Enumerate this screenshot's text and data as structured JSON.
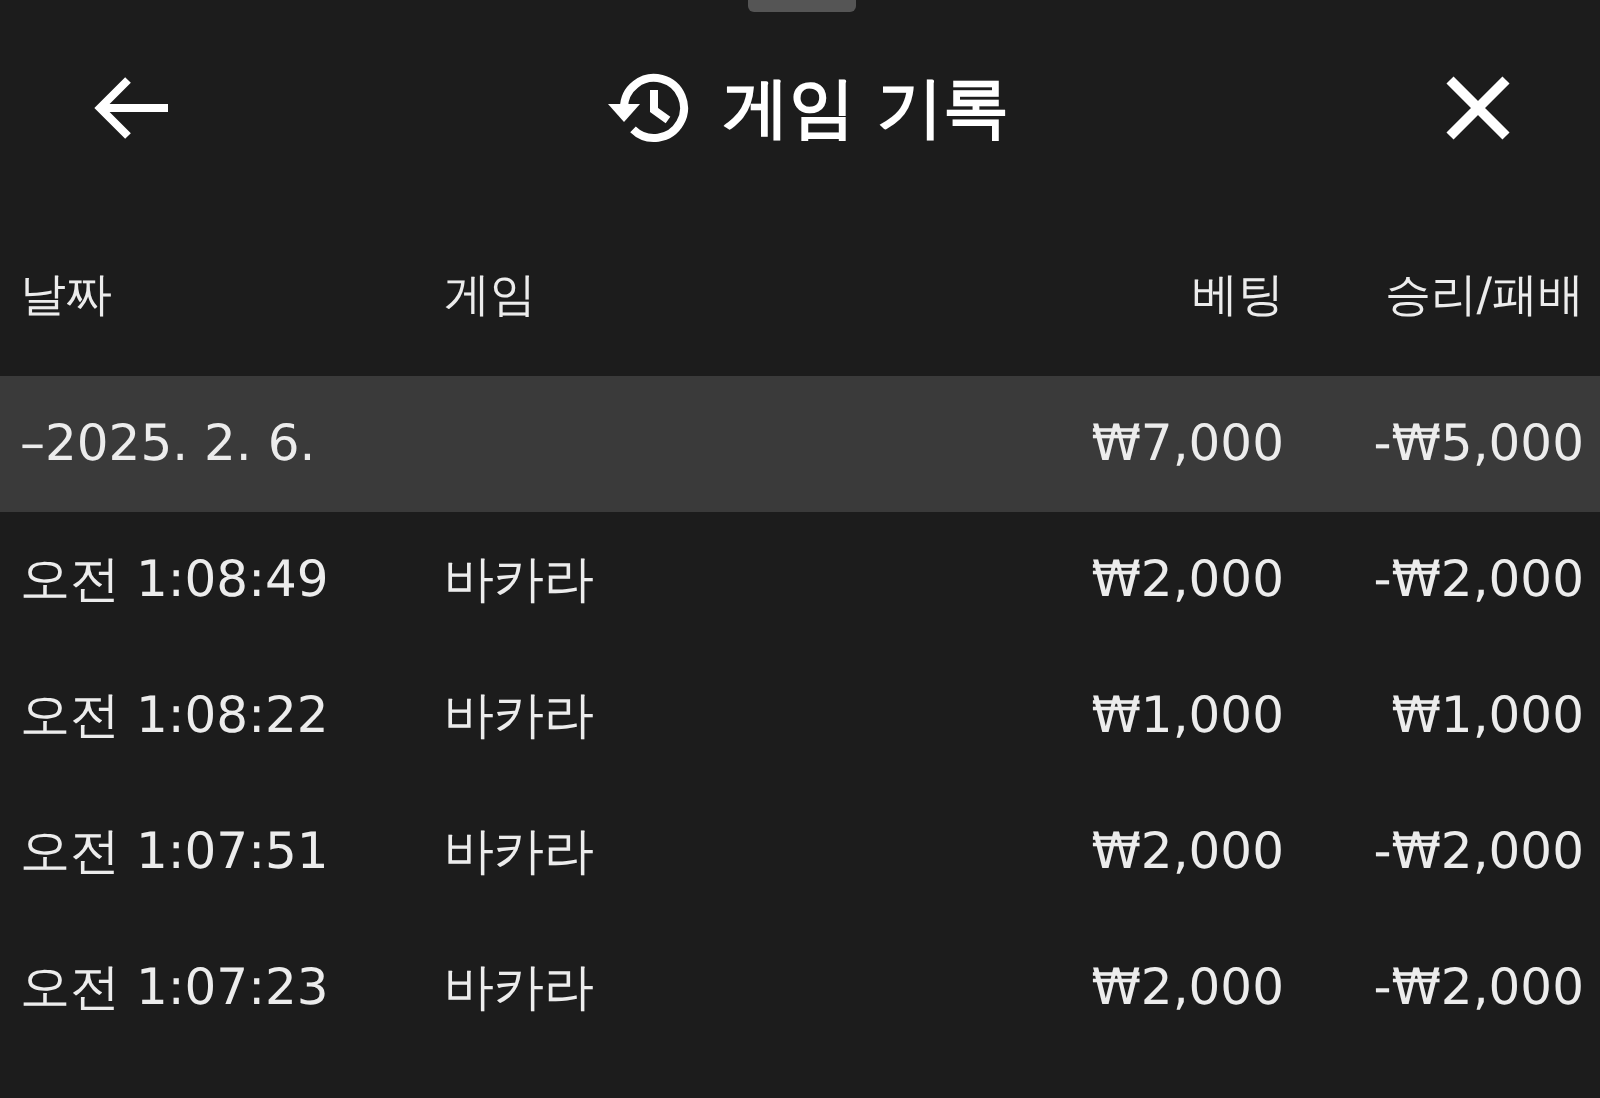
{
  "header": {
    "title": "게임 기록"
  },
  "columns": [
    "날짜",
    "게임",
    "베팅",
    "승리/패배"
  ],
  "group": {
    "date": "–2025. 2. 6.",
    "bet": "₩7,000",
    "result": "-₩5,000"
  },
  "rows": [
    {
      "time": "오전 1:08:49",
      "game": "바카라",
      "bet": "₩2,000",
      "result": "-₩2,000"
    },
    {
      "time": "오전 1:08:22",
      "game": "바카라",
      "bet": "₩1,000",
      "result": "₩1,000"
    },
    {
      "time": "오전 1:07:51",
      "game": "바카라",
      "bet": "₩2,000",
      "result": "-₩2,000"
    },
    {
      "time": "오전 1:07:23",
      "game": "바카라",
      "bet": "₩2,000",
      "result": "-₩2,000"
    }
  ]
}
